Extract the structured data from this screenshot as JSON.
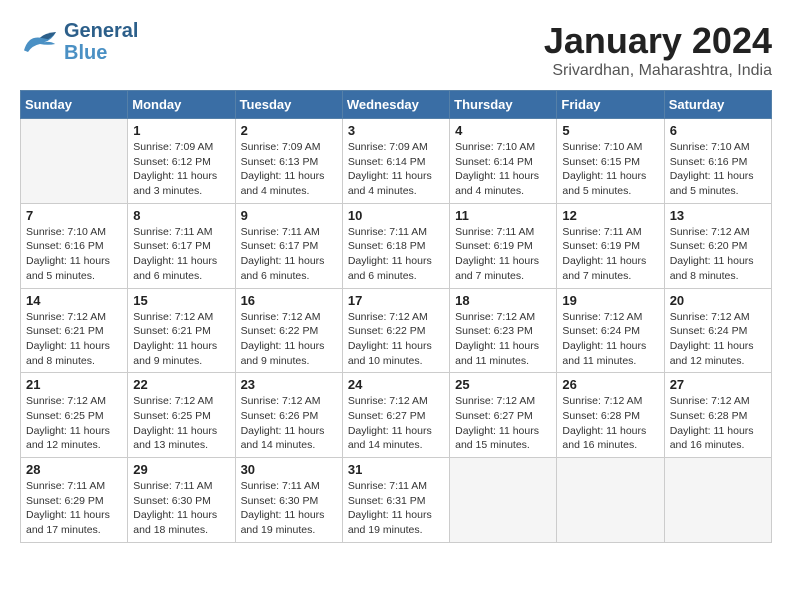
{
  "logo": {
    "line1": "General",
    "line2": "Blue"
  },
  "title": "January 2024",
  "subtitle": "Srivardhan, Maharashtra, India",
  "days_of_week": [
    "Sunday",
    "Monday",
    "Tuesday",
    "Wednesday",
    "Thursday",
    "Friday",
    "Saturday"
  ],
  "weeks": [
    [
      {
        "day": "",
        "info": ""
      },
      {
        "day": "1",
        "info": "Sunrise: 7:09 AM\nSunset: 6:12 PM\nDaylight: 11 hours\nand 3 minutes."
      },
      {
        "day": "2",
        "info": "Sunrise: 7:09 AM\nSunset: 6:13 PM\nDaylight: 11 hours\nand 4 minutes."
      },
      {
        "day": "3",
        "info": "Sunrise: 7:09 AM\nSunset: 6:14 PM\nDaylight: 11 hours\nand 4 minutes."
      },
      {
        "day": "4",
        "info": "Sunrise: 7:10 AM\nSunset: 6:14 PM\nDaylight: 11 hours\nand 4 minutes."
      },
      {
        "day": "5",
        "info": "Sunrise: 7:10 AM\nSunset: 6:15 PM\nDaylight: 11 hours\nand 5 minutes."
      },
      {
        "day": "6",
        "info": "Sunrise: 7:10 AM\nSunset: 6:16 PM\nDaylight: 11 hours\nand 5 minutes."
      }
    ],
    [
      {
        "day": "7",
        "info": "Sunrise: 7:10 AM\nSunset: 6:16 PM\nDaylight: 11 hours\nand 5 minutes."
      },
      {
        "day": "8",
        "info": "Sunrise: 7:11 AM\nSunset: 6:17 PM\nDaylight: 11 hours\nand 6 minutes."
      },
      {
        "day": "9",
        "info": "Sunrise: 7:11 AM\nSunset: 6:17 PM\nDaylight: 11 hours\nand 6 minutes."
      },
      {
        "day": "10",
        "info": "Sunrise: 7:11 AM\nSunset: 6:18 PM\nDaylight: 11 hours\nand 6 minutes."
      },
      {
        "day": "11",
        "info": "Sunrise: 7:11 AM\nSunset: 6:19 PM\nDaylight: 11 hours\nand 7 minutes."
      },
      {
        "day": "12",
        "info": "Sunrise: 7:11 AM\nSunset: 6:19 PM\nDaylight: 11 hours\nand 7 minutes."
      },
      {
        "day": "13",
        "info": "Sunrise: 7:12 AM\nSunset: 6:20 PM\nDaylight: 11 hours\nand 8 minutes."
      }
    ],
    [
      {
        "day": "14",
        "info": "Sunrise: 7:12 AM\nSunset: 6:21 PM\nDaylight: 11 hours\nand 8 minutes."
      },
      {
        "day": "15",
        "info": "Sunrise: 7:12 AM\nSunset: 6:21 PM\nDaylight: 11 hours\nand 9 minutes."
      },
      {
        "day": "16",
        "info": "Sunrise: 7:12 AM\nSunset: 6:22 PM\nDaylight: 11 hours\nand 9 minutes."
      },
      {
        "day": "17",
        "info": "Sunrise: 7:12 AM\nSunset: 6:22 PM\nDaylight: 11 hours\nand 10 minutes."
      },
      {
        "day": "18",
        "info": "Sunrise: 7:12 AM\nSunset: 6:23 PM\nDaylight: 11 hours\nand 11 minutes."
      },
      {
        "day": "19",
        "info": "Sunrise: 7:12 AM\nSunset: 6:24 PM\nDaylight: 11 hours\nand 11 minutes."
      },
      {
        "day": "20",
        "info": "Sunrise: 7:12 AM\nSunset: 6:24 PM\nDaylight: 11 hours\nand 12 minutes."
      }
    ],
    [
      {
        "day": "21",
        "info": "Sunrise: 7:12 AM\nSunset: 6:25 PM\nDaylight: 11 hours\nand 12 minutes."
      },
      {
        "day": "22",
        "info": "Sunrise: 7:12 AM\nSunset: 6:25 PM\nDaylight: 11 hours\nand 13 minutes."
      },
      {
        "day": "23",
        "info": "Sunrise: 7:12 AM\nSunset: 6:26 PM\nDaylight: 11 hours\nand 14 minutes."
      },
      {
        "day": "24",
        "info": "Sunrise: 7:12 AM\nSunset: 6:27 PM\nDaylight: 11 hours\nand 14 minutes."
      },
      {
        "day": "25",
        "info": "Sunrise: 7:12 AM\nSunset: 6:27 PM\nDaylight: 11 hours\nand 15 minutes."
      },
      {
        "day": "26",
        "info": "Sunrise: 7:12 AM\nSunset: 6:28 PM\nDaylight: 11 hours\nand 16 minutes."
      },
      {
        "day": "27",
        "info": "Sunrise: 7:12 AM\nSunset: 6:28 PM\nDaylight: 11 hours\nand 16 minutes."
      }
    ],
    [
      {
        "day": "28",
        "info": "Sunrise: 7:11 AM\nSunset: 6:29 PM\nDaylight: 11 hours\nand 17 minutes."
      },
      {
        "day": "29",
        "info": "Sunrise: 7:11 AM\nSunset: 6:30 PM\nDaylight: 11 hours\nand 18 minutes."
      },
      {
        "day": "30",
        "info": "Sunrise: 7:11 AM\nSunset: 6:30 PM\nDaylight: 11 hours\nand 19 minutes."
      },
      {
        "day": "31",
        "info": "Sunrise: 7:11 AM\nSunset: 6:31 PM\nDaylight: 11 hours\nand 19 minutes."
      },
      {
        "day": "",
        "info": ""
      },
      {
        "day": "",
        "info": ""
      },
      {
        "day": "",
        "info": ""
      }
    ]
  ]
}
